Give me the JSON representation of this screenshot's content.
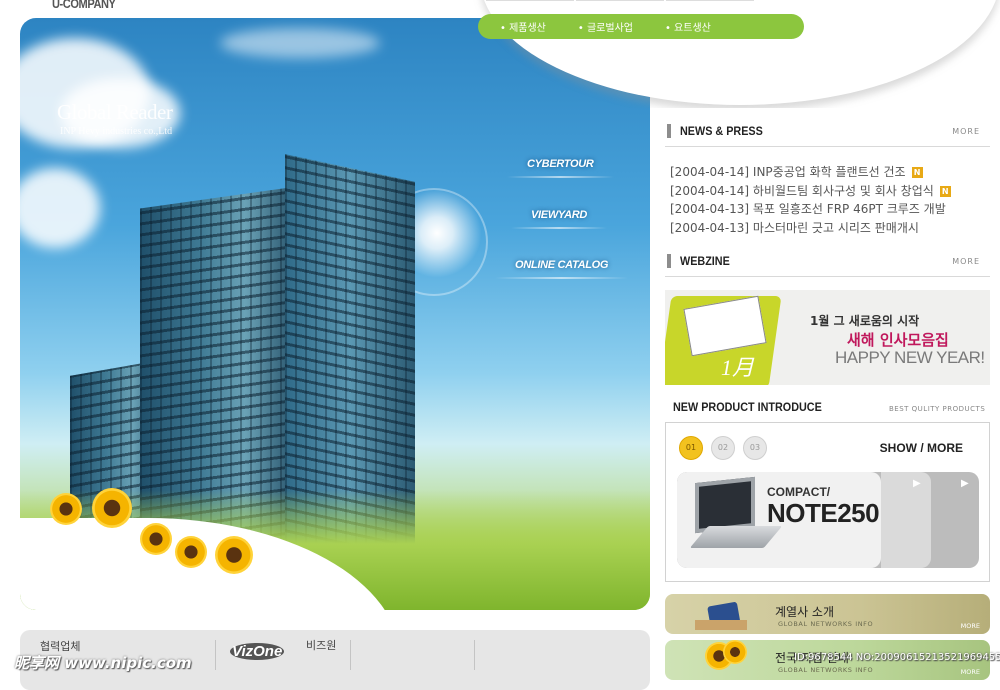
{
  "brand": {
    "logo": "U-COMPANY"
  },
  "topnav": {
    "items": [
      "제품생산",
      "글로벌사업",
      "요트생산"
    ],
    "accent_color": "#8cc63e"
  },
  "hero": {
    "title": "Global Reader",
    "subtitle": "INP Hevy industries co.,Ltd",
    "links": [
      "CYBERTOUR",
      "VIEWYARD",
      "ONLINE CATALOG"
    ]
  },
  "news": {
    "title": "NEWS & PRESS",
    "more": "MORE",
    "items": [
      {
        "text": "[2004-04-14] INP중공업 화학 플랜트선 건조",
        "badge": "N"
      },
      {
        "text": "[2004-04-14] 하비월드팀 회사구성 및 회사 창업식",
        "badge": "N"
      },
      {
        "text": "[2004-04-13] 목포 일흥조선 FRP 46PT 크루즈 개발",
        "badge": ""
      },
      {
        "text": "[2004-04-13] 마스터마린 긋고 시리즈 판매개시",
        "badge": ""
      }
    ]
  },
  "webzine": {
    "title": "WEBZINE",
    "more": "MORE",
    "line1": "1월 그 새로움의 시작",
    "line2": "새해 인사모음집",
    "line3": "HAPPY NEW YEAR!",
    "badge": "1月"
  },
  "new_product": {
    "title": "NEW PRODUCT INTRODUCE",
    "subtitle": "BEST QULITY PRODUCTS",
    "pages": [
      "01",
      "02",
      "03"
    ],
    "active_page": 0,
    "show_more": "SHOW / MORE",
    "label": "COMPACT/",
    "model": "NOTE250"
  },
  "banners": [
    {
      "title": "계열사 소개",
      "sub": "GLOBAL NETWORKS INFO",
      "more": "MORE"
    },
    {
      "title": "전국 지점 안내",
      "sub": "GLOBAL NETWORKS INFO",
      "more": "MORE"
    }
  ],
  "partners": {
    "label": "협력업체",
    "logo": "VizOne",
    "biz": "비즈원"
  },
  "watermark": {
    "left": "昵享网 www.nipic.com",
    "right": "ID:9678544 NO:20090615213521969455"
  }
}
